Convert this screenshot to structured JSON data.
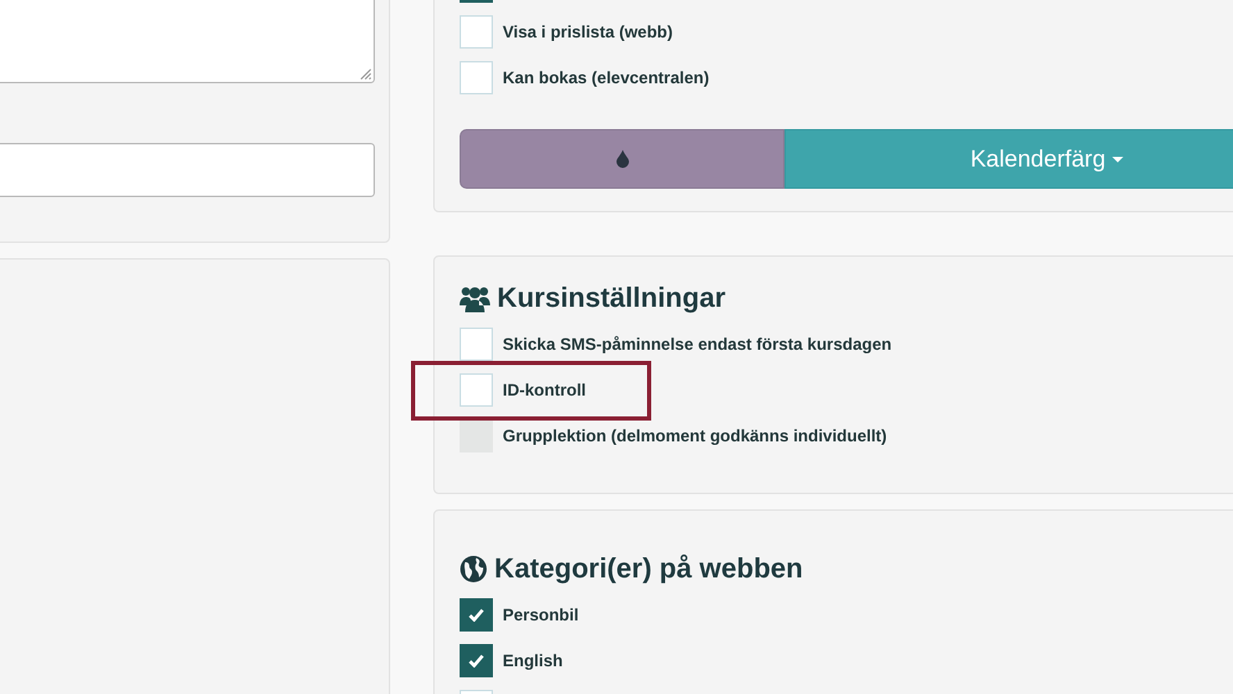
{
  "general_options": [
    {
      "checked": true
    },
    {
      "label": "Visa i prislista (webb)",
      "checked": false
    },
    {
      "label": "Kan bokas (elevcentralen)",
      "checked": false
    }
  ],
  "calendar_color": {
    "color": "#9886a3",
    "button": "Kalenderfärg"
  },
  "course_settings": {
    "title": "Kursinställningar",
    "options": [
      {
        "label": "Skicka SMS-påminnelse endast första kursdagen",
        "checked": false,
        "disabled": false
      },
      {
        "label": "ID-kontroll",
        "checked": false,
        "disabled": false
      },
      {
        "label": "Grupplektion (delmoment godkänns individuellt)",
        "checked": false,
        "disabled": true
      }
    ]
  },
  "web_categories": {
    "title": "Kategori(er) på webben",
    "options": [
      {
        "label": "Personbil",
        "checked": true
      },
      {
        "label": "English",
        "checked": true
      },
      {
        "checked": false
      }
    ]
  }
}
